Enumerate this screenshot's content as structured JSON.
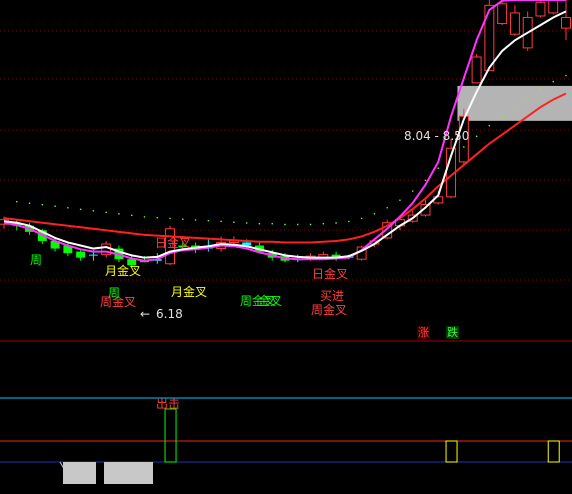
{
  "chart_data": {
    "type": "candlestick",
    "main_panel": {
      "price_range": [
        5.42,
        9.63
      ],
      "candles": [
        {
          "o": 6.68,
          "c": 6.74,
          "h": 6.78,
          "l": 6.62,
          "dir": "up"
        },
        {
          "o": 6.7,
          "c": 6.66,
          "h": 6.74,
          "l": 6.6,
          "dir": "down"
        },
        {
          "o": 6.66,
          "c": 6.58,
          "h": 6.7,
          "l": 6.54,
          "dir": "down"
        },
        {
          "o": 6.6,
          "c": 6.46,
          "h": 6.62,
          "l": 6.42,
          "dir": "down"
        },
        {
          "o": 6.46,
          "c": 6.36,
          "h": 6.5,
          "l": 6.32,
          "dir": "down"
        },
        {
          "o": 6.4,
          "c": 6.3,
          "h": 6.44,
          "l": 6.26,
          "dir": "down"
        },
        {
          "o": 6.32,
          "c": 6.24,
          "h": 6.34,
          "l": 6.2,
          "dir": "down"
        },
        {
          "o": 6.28,
          "c": 6.28,
          "h": 6.34,
          "l": 6.2,
          "dir": "flat"
        },
        {
          "o": 6.28,
          "c": 6.42,
          "h": 6.46,
          "l": 6.24,
          "dir": "up"
        },
        {
          "o": 6.36,
          "c": 6.22,
          "h": 6.4,
          "l": 6.18,
          "dir": "down"
        },
        {
          "o": 6.22,
          "c": 6.14,
          "h": 6.26,
          "l": 6.12,
          "dir": "down"
        },
        {
          "o": 6.2,
          "c": 6.18,
          "h": 6.26,
          "l": 6.18,
          "dir": "down"
        },
        {
          "o": 6.22,
          "c": 6.2,
          "h": 6.3,
          "l": 6.16,
          "dir": "flat"
        },
        {
          "o": 6.16,
          "c": 6.62,
          "h": 6.66,
          "l": 6.14,
          "dir": "up"
        },
        {
          "o": 6.4,
          "c": 6.38,
          "h": 6.46,
          "l": 6.32,
          "dir": "down"
        },
        {
          "o": 6.4,
          "c": 6.36,
          "h": 6.44,
          "l": 6.3,
          "dir": "down"
        },
        {
          "o": 6.38,
          "c": 6.36,
          "h": 6.5,
          "l": 6.32,
          "dir": "flat"
        },
        {
          "o": 6.36,
          "c": 6.44,
          "h": 6.52,
          "l": 6.32,
          "dir": "up"
        },
        {
          "o": 6.44,
          "c": 6.46,
          "h": 6.52,
          "l": 6.38,
          "dir": "up"
        },
        {
          "o": 6.44,
          "c": 6.4,
          "h": 6.48,
          "l": 6.36,
          "dir": "flat"
        },
        {
          "o": 6.4,
          "c": 6.32,
          "h": 6.44,
          "l": 6.3,
          "dir": "down"
        },
        {
          "o": 6.3,
          "c": 6.24,
          "h": 6.34,
          "l": 6.2,
          "dir": "down"
        },
        {
          "o": 6.26,
          "c": 6.2,
          "h": 6.3,
          "l": 6.18,
          "dir": "down"
        },
        {
          "o": 6.22,
          "c": 6.22,
          "h": 6.28,
          "l": 6.18,
          "dir": "flat"
        },
        {
          "o": 6.22,
          "c": 6.26,
          "h": 6.3,
          "l": 6.2,
          "dir": "up"
        },
        {
          "o": 6.24,
          "c": 6.28,
          "h": 6.32,
          "l": 6.22,
          "dir": "up"
        },
        {
          "o": 6.28,
          "c": 6.24,
          "h": 6.32,
          "l": 6.2,
          "dir": "down"
        },
        {
          "o": 6.26,
          "c": 6.24,
          "h": 6.28,
          "l": 6.22,
          "dir": "flat"
        },
        {
          "o": 6.22,
          "c": 6.38,
          "h": 6.4,
          "l": 6.2,
          "dir": "up"
        },
        {
          "o": 6.42,
          "c": 6.46,
          "h": 6.5,
          "l": 6.38,
          "dir": "up"
        },
        {
          "o": 6.5,
          "c": 6.7,
          "h": 6.74,
          "l": 6.48,
          "dir": "up"
        },
        {
          "o": 6.66,
          "c": 6.74,
          "h": 6.8,
          "l": 6.6,
          "dir": "up"
        },
        {
          "o": 6.72,
          "c": 6.8,
          "h": 6.86,
          "l": 6.7,
          "dir": "up"
        },
        {
          "o": 6.8,
          "c": 6.94,
          "h": 7.0,
          "l": 6.78,
          "dir": "up"
        },
        {
          "o": 6.96,
          "c": 7.04,
          "h": 7.12,
          "l": 6.94,
          "dir": "up"
        },
        {
          "o": 7.04,
          "c": 7.68,
          "h": 7.8,
          "l": 7.02,
          "dir": "up"
        },
        {
          "o": 7.5,
          "c": 8.1,
          "h": 8.2,
          "l": 7.46,
          "dir": "up"
        },
        {
          "o": 8.54,
          "c": 8.88,
          "h": 8.92,
          "l": 8.54,
          "dir": "up"
        },
        {
          "o": 8.7,
          "c": 9.56,
          "h": 9.63,
          "l": 8.7,
          "dir": "up"
        },
        {
          "o": 9.32,
          "c": 9.58,
          "h": 9.63,
          "l": 9.3,
          "dir": "up"
        },
        {
          "o": 9.18,
          "c": 9.46,
          "h": 9.56,
          "l": 9.16,
          "dir": "up"
        },
        {
          "o": 9.0,
          "c": 9.4,
          "h": 9.48,
          "l": 8.96,
          "dir": "up"
        },
        {
          "o": 9.42,
          "c": 9.6,
          "h": 9.63,
          "l": 9.4,
          "dir": "up"
        },
        {
          "o": 9.46,
          "c": 9.63,
          "h": 9.63,
          "l": 9.44,
          "dir": "up"
        },
        {
          "o": 9.4,
          "c": 9.26,
          "h": 9.63,
          "l": 9.1,
          "dir": "up"
        }
      ],
      "white_line": [
        6.72,
        6.7,
        6.66,
        6.58,
        6.5,
        6.44,
        6.4,
        6.36,
        6.38,
        6.32,
        6.27,
        6.24,
        6.25,
        6.32,
        6.35,
        6.37,
        6.39,
        6.42,
        6.41,
        6.39,
        6.35,
        6.31,
        6.27,
        6.25,
        6.24,
        6.24,
        6.24,
        6.26,
        6.33,
        6.42,
        6.54,
        6.66,
        6.76,
        6.9,
        7.06,
        7.58,
        8.06,
        8.42,
        8.74,
        8.96,
        9.1,
        9.2,
        9.3,
        9.4,
        9.48
      ],
      "magenta_line": [
        6.7,
        6.67,
        6.62,
        6.54,
        6.46,
        6.4,
        6.35,
        6.32,
        6.32,
        6.28,
        6.23,
        6.2,
        6.22,
        6.3,
        6.34,
        6.35,
        6.37,
        6.4,
        6.39,
        6.36,
        6.31,
        6.27,
        6.23,
        6.22,
        6.22,
        6.22,
        6.23,
        6.24,
        6.34,
        6.48,
        6.62,
        6.78,
        6.96,
        7.2,
        7.5,
        8.1,
        8.6,
        9.1,
        9.5,
        9.62,
        9.63,
        9.63,
        9.63,
        9.63,
        9.63
      ],
      "red_line": [
        6.76,
        6.74,
        6.72,
        6.7,
        6.68,
        6.66,
        6.64,
        6.62,
        6.6,
        6.58,
        6.56,
        6.54,
        6.53,
        6.52,
        6.51,
        6.5,
        6.49,
        6.48,
        6.47,
        6.46,
        6.45,
        6.45,
        6.44,
        6.44,
        6.44,
        6.45,
        6.46,
        6.48,
        6.52,
        6.58,
        6.66,
        6.76,
        6.88,
        7.02,
        7.18,
        7.32,
        7.46,
        7.6,
        7.74,
        7.86,
        7.98,
        8.1,
        8.22,
        8.32,
        8.4
      ],
      "zone": {
        "low": 8.04,
        "high": 8.5
      },
      "annotations": {
        "zone_label": "8.04 - 8.50",
        "min_price": "6.18",
        "min_arrow": "←",
        "day_golden_cross": "日金叉",
        "month_golden_cross": "月金叉",
        "month_golden_cross_2": "月金叉",
        "week_golden_cross": "周金叉",
        "week_golden_cross_2": "周金叉",
        "week_golden_cross_3": "周金叉",
        "day_golden_cross_2": "日金叉",
        "buy_in": "买进",
        "zhou_1": "周",
        "zhou_2": "周",
        "gold_cross_short": "金叉"
      }
    },
    "zhang_label": "涨",
    "die_label": "跌",
    "indicator_panel": {
      "label": "出击",
      "signal_bars": [
        13,
        35,
        43
      ]
    },
    "colors": {
      "up": "#ff3c3c",
      "down": "#00ff00",
      "white_line": "#ffffff",
      "magenta_line": "#ff33ff",
      "red_line": "#ff2020",
      "zone": "#b4b4b4",
      "grid": "#8b0000",
      "cyan": "#00c8ff"
    }
  }
}
